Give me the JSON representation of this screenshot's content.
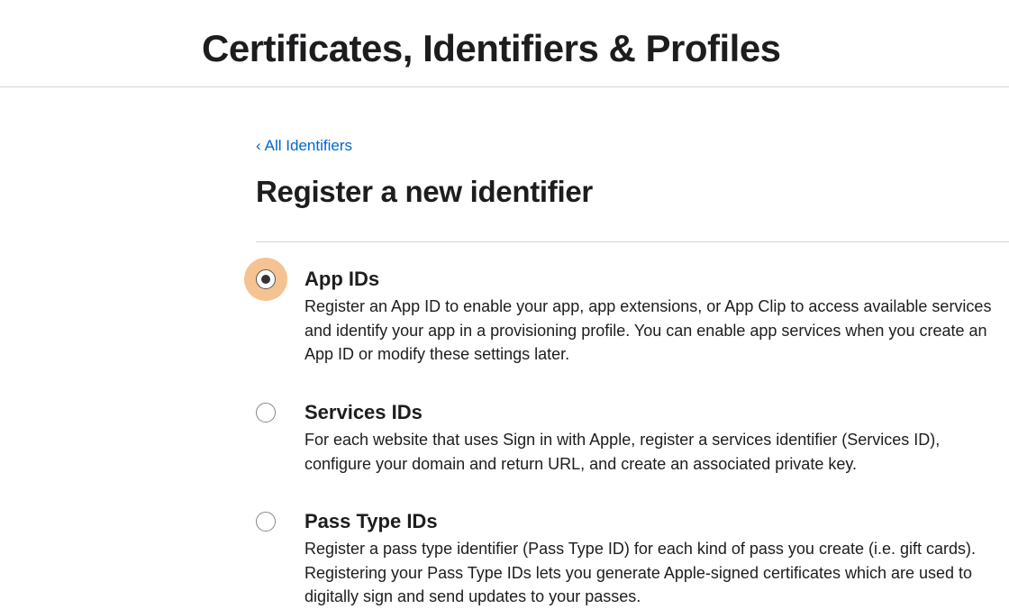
{
  "page": {
    "title": "Certificates, Identifiers & Profiles",
    "back_link": "All Identifiers",
    "section_title": "Register a new identifier"
  },
  "options": [
    {
      "title": "App IDs",
      "description": "Register an App ID to enable your app, app extensions, or App Clip to access available services and identify your app in a provisioning profile. You can enable app services when you create an App ID or modify these settings later.",
      "selected": true,
      "highlighted": true
    },
    {
      "title": "Services IDs",
      "description": "For each website that uses Sign in with Apple, register a services identifier (Services ID), configure your domain and return URL, and create an associated private key.",
      "selected": false,
      "highlighted": false
    },
    {
      "title": "Pass Type IDs",
      "description": "Register a pass type identifier (Pass Type ID) for each kind of pass you create (i.e. gift cards). Registering your Pass Type IDs lets you generate Apple-signed certificates which are used to digitally sign and send updates to your passes.",
      "selected": false,
      "highlighted": false
    }
  ]
}
